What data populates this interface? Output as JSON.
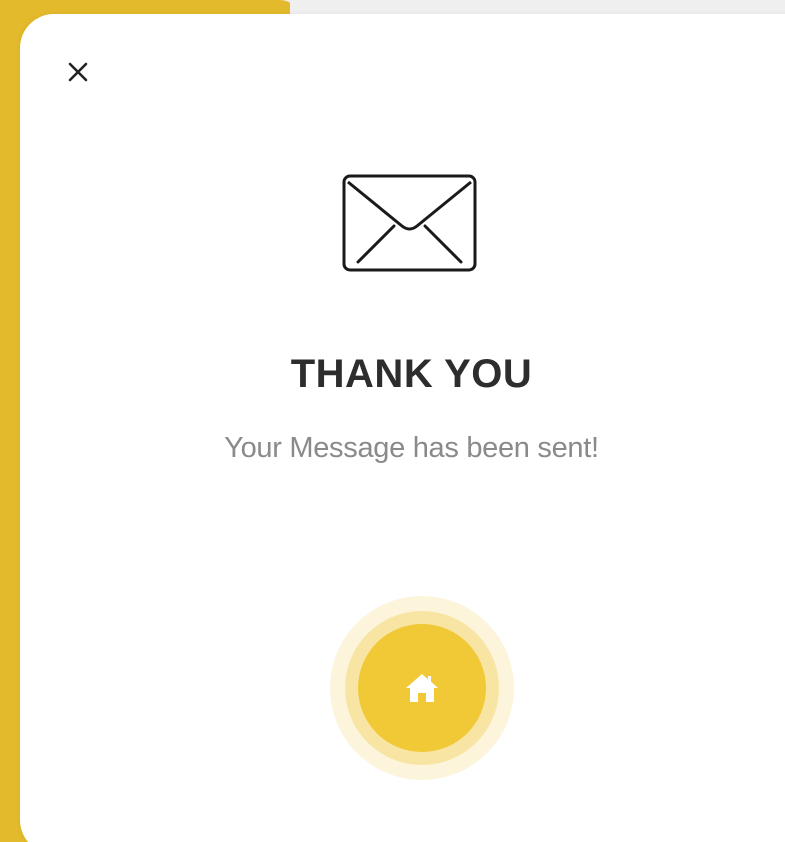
{
  "dialog": {
    "title": "THANK YOU",
    "message": "Your Message has been sent!",
    "close_label": "X"
  },
  "icons": {
    "close": "close-icon",
    "envelope": "envelope-icon",
    "home": "home-icon"
  },
  "colors": {
    "accent": "#f1c836",
    "backdrop_accent": "#e3ba2c",
    "title": "#2d2d2d",
    "message": "#8a8a8a",
    "surface": "#ffffff"
  }
}
